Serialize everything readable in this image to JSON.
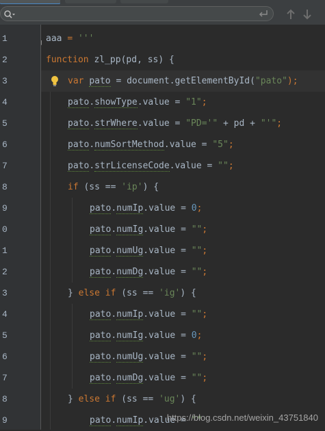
{
  "search": {
    "value": "",
    "placeholder": ""
  },
  "editor": {
    "line_numbers": [
      "1",
      "2",
      "3",
      "4",
      "5",
      "6",
      "7",
      "8",
      "9",
      "0",
      "1",
      "2",
      "3",
      "4",
      "5",
      "6",
      "7",
      "8",
      "9"
    ],
    "lines": [
      {
        "indent": 0,
        "tokens": [
          {
            "t": "aaa ",
            "c": "plain"
          },
          {
            "t": "= ",
            "c": "kw"
          },
          {
            "t": "'''",
            "c": "str"
          }
        ]
      },
      {
        "indent": 0,
        "tokens": [
          {
            "t": "function ",
            "c": "kw"
          },
          {
            "t": "zl_pp",
            "c": "plain"
          },
          {
            "t": "(pd, ss) {",
            "c": "plain"
          }
        ]
      },
      {
        "indent": 1,
        "current": true,
        "bulb": true,
        "tokens": [
          {
            "t": "var ",
            "c": "kw"
          },
          {
            "t": "pato",
            "c": "plain warn"
          },
          {
            "t": " = document.getElementById(",
            "c": "plain"
          },
          {
            "t": "\"pato\"",
            "c": "str"
          },
          {
            "t": ");",
            "c": "kw"
          }
        ]
      },
      {
        "indent": 1,
        "tokens": [
          {
            "t": "pato",
            "c": "plain warn"
          },
          {
            "t": ".",
            "c": "plain"
          },
          {
            "t": "showType",
            "c": "plain warn"
          },
          {
            "t": ".value = ",
            "c": "plain"
          },
          {
            "t": "\"1\"",
            "c": "str"
          },
          {
            "t": ";",
            "c": "kw"
          }
        ]
      },
      {
        "indent": 1,
        "tokens": [
          {
            "t": "pato",
            "c": "plain warn"
          },
          {
            "t": ".",
            "c": "plain"
          },
          {
            "t": "strWhere",
            "c": "plain warn"
          },
          {
            "t": ".value = ",
            "c": "plain"
          },
          {
            "t": "\"PD='\"",
            "c": "str"
          },
          {
            "t": " + pd + ",
            "c": "plain"
          },
          {
            "t": "\"'\"",
            "c": "str"
          },
          {
            "t": ";",
            "c": "kw"
          }
        ]
      },
      {
        "indent": 1,
        "tokens": [
          {
            "t": "pato",
            "c": "plain warn"
          },
          {
            "t": ".",
            "c": "plain"
          },
          {
            "t": "numSortMethod",
            "c": "plain warn"
          },
          {
            "t": ".value = ",
            "c": "plain"
          },
          {
            "t": "\"5\"",
            "c": "str"
          },
          {
            "t": ";",
            "c": "kw"
          }
        ]
      },
      {
        "indent": 1,
        "tokens": [
          {
            "t": "pato",
            "c": "plain warn"
          },
          {
            "t": ".",
            "c": "plain"
          },
          {
            "t": "strLicenseCode",
            "c": "plain warn"
          },
          {
            "t": ".value = ",
            "c": "plain"
          },
          {
            "t": "\"\"",
            "c": "str"
          },
          {
            "t": ";",
            "c": "kw"
          }
        ]
      },
      {
        "indent": 1,
        "tokens": [
          {
            "t": "if ",
            "c": "kw"
          },
          {
            "t": "(ss == ",
            "c": "plain"
          },
          {
            "t": "'ip'",
            "c": "str"
          },
          {
            "t": ") {",
            "c": "plain"
          }
        ]
      },
      {
        "indent": 2,
        "tokens": [
          {
            "t": "pato",
            "c": "plain warn"
          },
          {
            "t": ".",
            "c": "plain"
          },
          {
            "t": "numIp",
            "c": "plain warn"
          },
          {
            "t": ".value = ",
            "c": "plain"
          },
          {
            "t": "0",
            "c": "num"
          },
          {
            "t": ";",
            "c": "kw"
          }
        ]
      },
      {
        "indent": 2,
        "tokens": [
          {
            "t": "pato",
            "c": "plain warn"
          },
          {
            "t": ".",
            "c": "plain"
          },
          {
            "t": "numIg",
            "c": "plain warn"
          },
          {
            "t": ".value = ",
            "c": "plain"
          },
          {
            "t": "\"\"",
            "c": "str"
          },
          {
            "t": ";",
            "c": "kw"
          }
        ]
      },
      {
        "indent": 2,
        "tokens": [
          {
            "t": "pato",
            "c": "plain warn"
          },
          {
            "t": ".",
            "c": "plain"
          },
          {
            "t": "numUg",
            "c": "plain warn"
          },
          {
            "t": ".value = ",
            "c": "plain"
          },
          {
            "t": "\"\"",
            "c": "str"
          },
          {
            "t": ";",
            "c": "kw"
          }
        ]
      },
      {
        "indent": 2,
        "tokens": [
          {
            "t": "pato",
            "c": "plain warn"
          },
          {
            "t": ".",
            "c": "plain"
          },
          {
            "t": "numDg",
            "c": "plain warn"
          },
          {
            "t": ".value = ",
            "c": "plain"
          },
          {
            "t": "\"\"",
            "c": "str"
          },
          {
            "t": ";",
            "c": "kw"
          }
        ]
      },
      {
        "indent": 1,
        "tokens": [
          {
            "t": "} ",
            "c": "plain"
          },
          {
            "t": "else if ",
            "c": "kw"
          },
          {
            "t": "(ss == ",
            "c": "plain"
          },
          {
            "t": "'ig'",
            "c": "str"
          },
          {
            "t": ") {",
            "c": "plain"
          }
        ]
      },
      {
        "indent": 2,
        "tokens": [
          {
            "t": "pato",
            "c": "plain warn"
          },
          {
            "t": ".",
            "c": "plain"
          },
          {
            "t": "numIp",
            "c": "plain warn"
          },
          {
            "t": ".value = ",
            "c": "plain"
          },
          {
            "t": "\"\"",
            "c": "str"
          },
          {
            "t": ";",
            "c": "kw"
          }
        ]
      },
      {
        "indent": 2,
        "tokens": [
          {
            "t": "pato",
            "c": "plain warn"
          },
          {
            "t": ".",
            "c": "plain"
          },
          {
            "t": "numIg",
            "c": "plain warn"
          },
          {
            "t": ".value = ",
            "c": "plain"
          },
          {
            "t": "0",
            "c": "num"
          },
          {
            "t": ";",
            "c": "kw"
          }
        ]
      },
      {
        "indent": 2,
        "tokens": [
          {
            "t": "pato",
            "c": "plain warn"
          },
          {
            "t": ".",
            "c": "plain"
          },
          {
            "t": "numUg",
            "c": "plain warn"
          },
          {
            "t": ".value = ",
            "c": "plain"
          },
          {
            "t": "\"\"",
            "c": "str"
          },
          {
            "t": ";",
            "c": "kw"
          }
        ]
      },
      {
        "indent": 2,
        "tokens": [
          {
            "t": "pato",
            "c": "plain warn"
          },
          {
            "t": ".",
            "c": "plain"
          },
          {
            "t": "numDg",
            "c": "plain warn"
          },
          {
            "t": ".value = ",
            "c": "plain"
          },
          {
            "t": "\"\"",
            "c": "str"
          },
          {
            "t": ";",
            "c": "kw"
          }
        ]
      },
      {
        "indent": 1,
        "tokens": [
          {
            "t": "} ",
            "c": "plain"
          },
          {
            "t": "else if ",
            "c": "kw"
          },
          {
            "t": "(ss == ",
            "c": "plain"
          },
          {
            "t": "'ug'",
            "c": "str"
          },
          {
            "t": ") {",
            "c": "plain"
          }
        ]
      },
      {
        "indent": 2,
        "tokens": [
          {
            "t": "pato",
            "c": "plain warn"
          },
          {
            "t": ".",
            "c": "plain"
          },
          {
            "t": "numIp",
            "c": "plain warn"
          },
          {
            "t": ".value = ",
            "c": "plain"
          },
          {
            "t": "\"\"",
            "c": "str"
          }
        ]
      }
    ]
  },
  "watermark": "https://blog.csdn.net/weixin_43751840",
  "icons": {
    "search": "magnifier-icon",
    "enter": "enter-icon",
    "prev": "arrow-up-icon",
    "next": "arrow-down-icon",
    "bulb": "lightbulb-icon",
    "fold": "fold-marker-icon"
  },
  "colors": {
    "background": "#2b2b2b",
    "gutter": "#313335",
    "keyword": "#cc7832",
    "string": "#6a8759",
    "number": "#6897bb",
    "text": "#a9b7c6",
    "current_line": "#323232"
  }
}
